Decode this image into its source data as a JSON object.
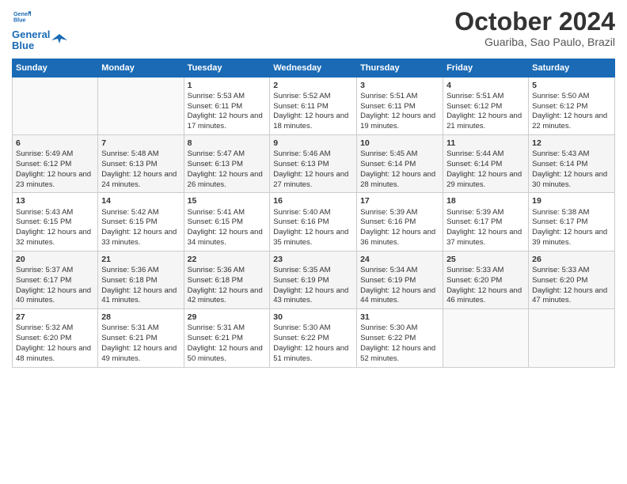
{
  "header": {
    "logo_line1": "General",
    "logo_line2": "Blue",
    "month": "October 2024",
    "location": "Guariba, Sao Paulo, Brazil"
  },
  "weekdays": [
    "Sunday",
    "Monday",
    "Tuesday",
    "Wednesday",
    "Thursday",
    "Friday",
    "Saturday"
  ],
  "weeks": [
    [
      {
        "day": "",
        "content": ""
      },
      {
        "day": "",
        "content": ""
      },
      {
        "day": "1",
        "content": "Sunrise: 5:53 AM\nSunset: 6:11 PM\nDaylight: 12 hours and 17 minutes."
      },
      {
        "day": "2",
        "content": "Sunrise: 5:52 AM\nSunset: 6:11 PM\nDaylight: 12 hours and 18 minutes."
      },
      {
        "day": "3",
        "content": "Sunrise: 5:51 AM\nSunset: 6:11 PM\nDaylight: 12 hours and 19 minutes."
      },
      {
        "day": "4",
        "content": "Sunrise: 5:51 AM\nSunset: 6:12 PM\nDaylight: 12 hours and 21 minutes."
      },
      {
        "day": "5",
        "content": "Sunrise: 5:50 AM\nSunset: 6:12 PM\nDaylight: 12 hours and 22 minutes."
      }
    ],
    [
      {
        "day": "6",
        "content": "Sunrise: 5:49 AM\nSunset: 6:12 PM\nDaylight: 12 hours and 23 minutes."
      },
      {
        "day": "7",
        "content": "Sunrise: 5:48 AM\nSunset: 6:13 PM\nDaylight: 12 hours and 24 minutes."
      },
      {
        "day": "8",
        "content": "Sunrise: 5:47 AM\nSunset: 6:13 PM\nDaylight: 12 hours and 26 minutes."
      },
      {
        "day": "9",
        "content": "Sunrise: 5:46 AM\nSunset: 6:13 PM\nDaylight: 12 hours and 27 minutes."
      },
      {
        "day": "10",
        "content": "Sunrise: 5:45 AM\nSunset: 6:14 PM\nDaylight: 12 hours and 28 minutes."
      },
      {
        "day": "11",
        "content": "Sunrise: 5:44 AM\nSunset: 6:14 PM\nDaylight: 12 hours and 29 minutes."
      },
      {
        "day": "12",
        "content": "Sunrise: 5:43 AM\nSunset: 6:14 PM\nDaylight: 12 hours and 30 minutes."
      }
    ],
    [
      {
        "day": "13",
        "content": "Sunrise: 5:43 AM\nSunset: 6:15 PM\nDaylight: 12 hours and 32 minutes."
      },
      {
        "day": "14",
        "content": "Sunrise: 5:42 AM\nSunset: 6:15 PM\nDaylight: 12 hours and 33 minutes."
      },
      {
        "day": "15",
        "content": "Sunrise: 5:41 AM\nSunset: 6:15 PM\nDaylight: 12 hours and 34 minutes."
      },
      {
        "day": "16",
        "content": "Sunrise: 5:40 AM\nSunset: 6:16 PM\nDaylight: 12 hours and 35 minutes."
      },
      {
        "day": "17",
        "content": "Sunrise: 5:39 AM\nSunset: 6:16 PM\nDaylight: 12 hours and 36 minutes."
      },
      {
        "day": "18",
        "content": "Sunrise: 5:39 AM\nSunset: 6:17 PM\nDaylight: 12 hours and 37 minutes."
      },
      {
        "day": "19",
        "content": "Sunrise: 5:38 AM\nSunset: 6:17 PM\nDaylight: 12 hours and 39 minutes."
      }
    ],
    [
      {
        "day": "20",
        "content": "Sunrise: 5:37 AM\nSunset: 6:17 PM\nDaylight: 12 hours and 40 minutes."
      },
      {
        "day": "21",
        "content": "Sunrise: 5:36 AM\nSunset: 6:18 PM\nDaylight: 12 hours and 41 minutes."
      },
      {
        "day": "22",
        "content": "Sunrise: 5:36 AM\nSunset: 6:18 PM\nDaylight: 12 hours and 42 minutes."
      },
      {
        "day": "23",
        "content": "Sunrise: 5:35 AM\nSunset: 6:19 PM\nDaylight: 12 hours and 43 minutes."
      },
      {
        "day": "24",
        "content": "Sunrise: 5:34 AM\nSunset: 6:19 PM\nDaylight: 12 hours and 44 minutes."
      },
      {
        "day": "25",
        "content": "Sunrise: 5:33 AM\nSunset: 6:20 PM\nDaylight: 12 hours and 46 minutes."
      },
      {
        "day": "26",
        "content": "Sunrise: 5:33 AM\nSunset: 6:20 PM\nDaylight: 12 hours and 47 minutes."
      }
    ],
    [
      {
        "day": "27",
        "content": "Sunrise: 5:32 AM\nSunset: 6:20 PM\nDaylight: 12 hours and 48 minutes."
      },
      {
        "day": "28",
        "content": "Sunrise: 5:31 AM\nSunset: 6:21 PM\nDaylight: 12 hours and 49 minutes."
      },
      {
        "day": "29",
        "content": "Sunrise: 5:31 AM\nSunset: 6:21 PM\nDaylight: 12 hours and 50 minutes."
      },
      {
        "day": "30",
        "content": "Sunrise: 5:30 AM\nSunset: 6:22 PM\nDaylight: 12 hours and 51 minutes."
      },
      {
        "day": "31",
        "content": "Sunrise: 5:30 AM\nSunset: 6:22 PM\nDaylight: 12 hours and 52 minutes."
      },
      {
        "day": "",
        "content": ""
      },
      {
        "day": "",
        "content": ""
      }
    ]
  ]
}
